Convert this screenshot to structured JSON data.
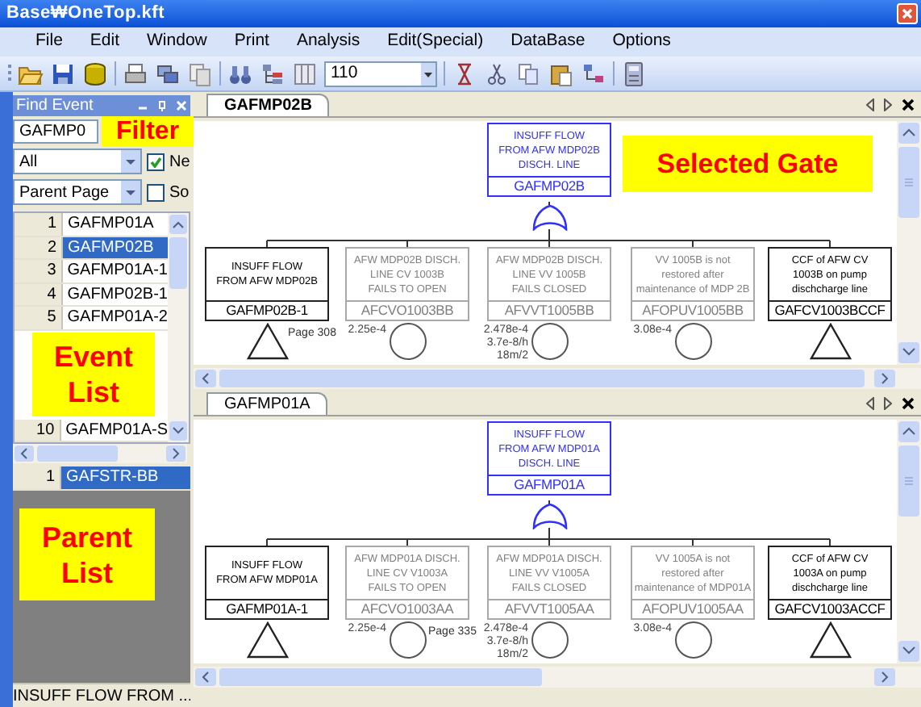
{
  "window": {
    "title": "Base₩OneTop.kft"
  },
  "menu": [
    "File",
    "Edit",
    "Window",
    "Print",
    "Analysis",
    "Edit(Special)",
    "DataBase",
    "Options"
  ],
  "toolbar": {
    "zoom_combo": "110"
  },
  "find_panel": {
    "title": "Find Event",
    "search": "GAFMP0",
    "filter_row": {
      "dropdown": "All",
      "checkbox_label": "Ne",
      "checked": true
    },
    "sort_row": {
      "dropdown": "Parent Page",
      "checkbox_label": "So",
      "checked": false
    },
    "events": [
      {
        "number": "1",
        "name": "GAFMP01A",
        "selected": false
      },
      {
        "number": "2",
        "name": "GAFMP02B",
        "selected": true
      },
      {
        "number": "3",
        "name": "GAFMP01A-1",
        "selected": false
      },
      {
        "number": "4",
        "name": "GAFMP02B-1",
        "selected": false
      },
      {
        "number": "5",
        "name": "GAFMP01A-2",
        "selected": false
      },
      {
        "number": "10",
        "name": "GAFMP01A-S",
        "selected": false
      }
    ],
    "parents": [
      {
        "number": "1",
        "name": "GAFSTR-BB",
        "selected": true
      }
    ],
    "status": "INSUFF FLOW FROM ..."
  },
  "documents": [
    {
      "tab": {
        "label": "GAFMP02B",
        "selected": true
      },
      "top_gate": {
        "description": "INSUFF FLOW\nFROM AFW MDP02B\nDISCH. LINE",
        "id": "GAFMP02B",
        "kind": "or"
      },
      "children": [
        {
          "kind": "transfer",
          "description": "INSUFF FLOW\nFROM AFW MDP02B",
          "id": "GAFMP02B-1",
          "page": "Page 308"
        },
        {
          "kind": "basic",
          "description": "AFW MDP02B DISCH.\nLINE CV 1003B\nFAILS TO OPEN",
          "id": "AFCVO1003BB",
          "values": [
            "2.25e-4"
          ]
        },
        {
          "kind": "basic",
          "description": "AFW MDP02B DISCH.\nLINE VV 1005B\nFAILS CLOSED",
          "id": "AFVVT1005BB",
          "values": [
            "2.478e-4",
            "3.7e-8/h",
            "18m/2"
          ]
        },
        {
          "kind": "basic",
          "description": "VV 1005B is not\nrestored after\nmaintenance of MDP 2B",
          "id": "AFOPUV1005BB",
          "values": [
            "3.08e-4"
          ]
        },
        {
          "kind": "transfer",
          "description": "CCF of AFW CV\n1003B on pump\ndischcharge line",
          "id": "GAFCV1003BCCF"
        }
      ]
    },
    {
      "tab": {
        "label": "GAFMP01A",
        "selected": false
      },
      "top_gate": {
        "description": "INSUFF FLOW\nFROM AFW MDP01A\nDISCH. LINE",
        "id": "GAFMP01A",
        "kind": "or"
      },
      "children": [
        {
          "kind": "transfer",
          "description": "INSUFF FLOW\nFROM AFW MDP01A",
          "id": "GAFMP01A-1"
        },
        {
          "kind": "basic",
          "description": "AFW MDP01A DISCH.\nLINE CV V1003A\nFAILS TO OPEN",
          "id": "AFCVO1003AA",
          "values": [
            "2.25e-4"
          ],
          "page": "Page 335"
        },
        {
          "kind": "basic",
          "description": "AFW MDP01A DISCH.\nLINE VV V1005A\nFAILS CLOSED",
          "id": "AFVVT1005AA",
          "values": [
            "2.478e-4",
            "3.7e-8/h",
            "18m/2"
          ]
        },
        {
          "kind": "basic",
          "description": "VV 1005A is not\nrestored after\nmaintenance of MDP01A",
          "id": "AFOPUV1005AA",
          "values": [
            "3.08e-4"
          ]
        },
        {
          "kind": "transfer",
          "description": "CCF of AFW CV\n1003A on pump\ndischcharge line",
          "id": "GAFCV1003ACCF"
        }
      ]
    }
  ],
  "annotations": [
    "Filter",
    "Selected Gate",
    "Event List",
    "Parent List"
  ]
}
